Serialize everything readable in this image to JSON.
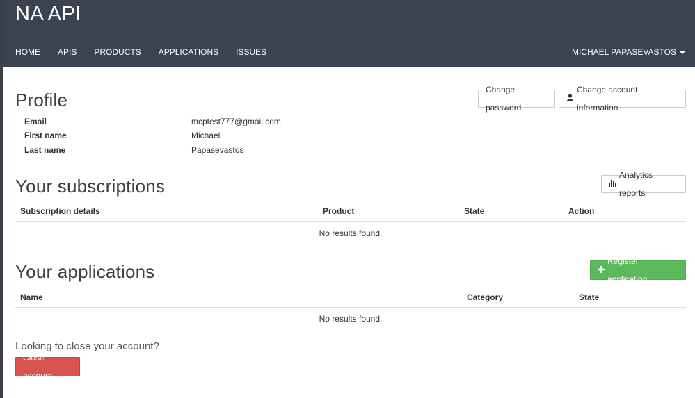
{
  "header": {
    "brand": "NA API",
    "nav": [
      "HOME",
      "APIS",
      "PRODUCTS",
      "APPLICATIONS",
      "ISSUES"
    ],
    "user": "MICHAEL PAPASEVASTOS"
  },
  "profile": {
    "title": "Profile",
    "change_password": "Change password",
    "change_account": "Change account information",
    "fields": [
      {
        "label": "Email",
        "value": "mcptest777@gmail.com"
      },
      {
        "label": "First name",
        "value": "Michael"
      },
      {
        "label": "Last name",
        "value": "Papasevastos"
      }
    ]
  },
  "subscriptions": {
    "title": "Your subscriptions",
    "analytics": "Analytics reports",
    "columns": [
      "Subscription details",
      "Product",
      "State",
      "Action"
    ],
    "empty": "No results found."
  },
  "applications": {
    "title": "Your applications",
    "register": "Register application",
    "columns": [
      "Name",
      "Category",
      "State"
    ],
    "empty": "No results found."
  },
  "close": {
    "question": "Looking to close your account?",
    "button": "Close account"
  },
  "colors": {
    "header": "#3b4250",
    "green": "#5cb85c",
    "red": "#d9534f"
  }
}
